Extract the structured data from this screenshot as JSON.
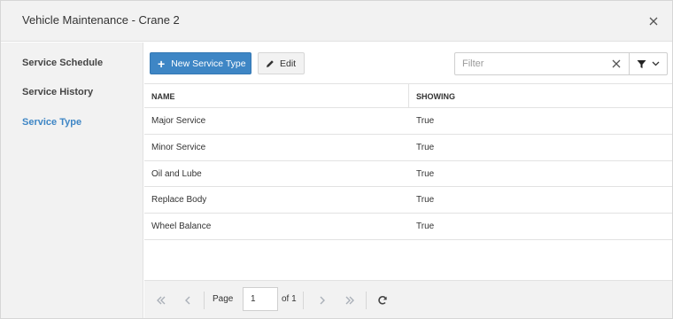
{
  "window": {
    "title": "Vehicle Maintenance - Crane 2"
  },
  "sidebar": {
    "items": [
      {
        "label": "Service Schedule",
        "active": false
      },
      {
        "label": "Service History",
        "active": false
      },
      {
        "label": "Service Type",
        "active": true
      }
    ]
  },
  "toolbar": {
    "new_label": "New Service Type",
    "edit_label": "Edit",
    "filter_placeholder": "Filter",
    "filter_value": ""
  },
  "grid": {
    "columns": [
      "NAME",
      "SHOWING"
    ],
    "rows": [
      {
        "name": "Major Service",
        "showing": "True"
      },
      {
        "name": "Minor Service",
        "showing": "True"
      },
      {
        "name": "Oil and Lube",
        "showing": "True"
      },
      {
        "name": "Replace Body",
        "showing": "True"
      },
      {
        "name": "Wheel Balance",
        "showing": "True"
      }
    ]
  },
  "pager": {
    "page_label": "Page",
    "page_value": "1",
    "of_label": "of 1"
  },
  "colors": {
    "accent": "#3e86c5",
    "panel_bg": "#f2f2f2",
    "border": "#e2e2e2"
  },
  "icons": [
    "close-icon",
    "plus-icon",
    "pencil-icon",
    "clear-icon",
    "funnel-icon",
    "chevron-down-icon",
    "first-page-icon",
    "previous-page-icon",
    "next-page-icon",
    "last-page-icon",
    "refresh-icon"
  ]
}
